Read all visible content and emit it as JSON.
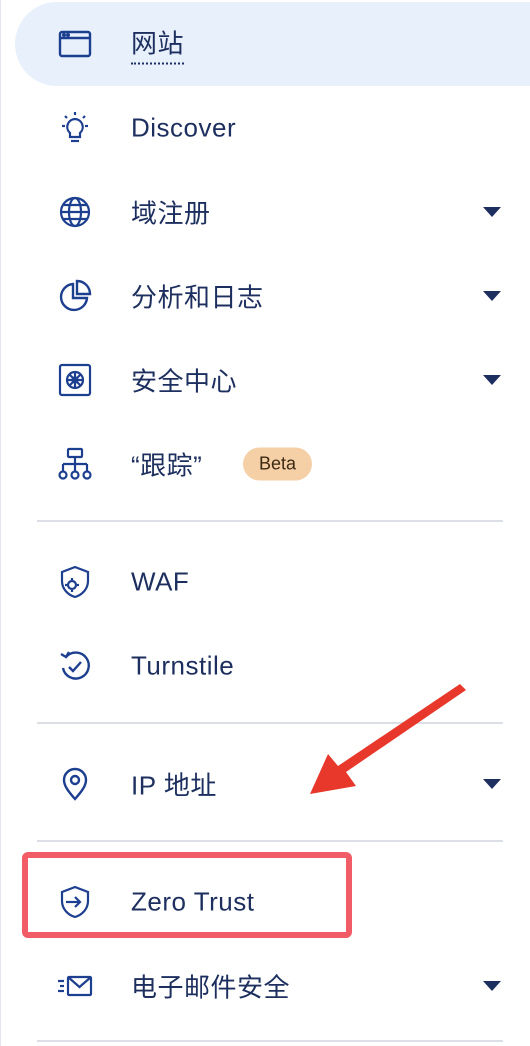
{
  "sidebar": {
    "items": [
      {
        "label": "网站",
        "icon": "browser-window-icon",
        "active": true
      },
      {
        "label": "Discover",
        "icon": "lightbulb-icon"
      },
      {
        "label": "域注册",
        "icon": "globe-www-icon",
        "expandable": true
      },
      {
        "label": "分析和日志",
        "icon": "pie-chart-icon",
        "expandable": true
      },
      {
        "label": "安全中心",
        "icon": "vault-icon",
        "expandable": true
      },
      {
        "label": "“跟踪”",
        "icon": "hierarchy-icon",
        "badge": "Beta"
      },
      {
        "label": "WAF",
        "icon": "shield-gear-icon"
      },
      {
        "label": "Turnstile",
        "icon": "check-refresh-icon"
      },
      {
        "label": "IP 地址",
        "icon": "location-pin-icon",
        "expandable": true
      },
      {
        "label": "Zero Trust",
        "icon": "shield-arrow-icon"
      },
      {
        "label": "电子邮件安全",
        "icon": "envelope-icon",
        "expandable": true
      }
    ]
  },
  "colors": {
    "text": "#1d2f5e",
    "active_bg": "#e8f0fb",
    "beta_bg": "#f5cfa6",
    "highlight": "#f25c67",
    "arrow": "#e8382c",
    "divider": "#dcdfe5"
  }
}
